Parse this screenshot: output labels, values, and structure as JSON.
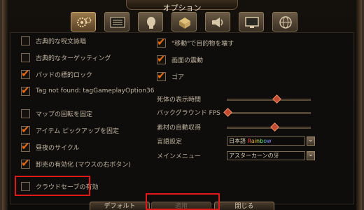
{
  "window": {
    "title": "オプション"
  },
  "tabs": [
    {
      "icon": "gameplay-gears-icon",
      "active": true
    },
    {
      "icon": "display-list-icon",
      "active": false
    },
    {
      "icon": "character-head-icon",
      "active": false
    },
    {
      "icon": "inventory-crate-icon",
      "active": false
    },
    {
      "icon": "audio-speaker-icon",
      "active": false
    },
    {
      "icon": "monitor-icon",
      "active": false
    },
    {
      "icon": "network-globe-icon",
      "active": false
    }
  ],
  "left_options": [
    {
      "label": "古典的な呪文詠唱",
      "checked": false
    },
    {
      "label": "古典的なターゲッティング",
      "checked": false
    },
    {
      "label": "パッドの標的ロック",
      "checked": true
    },
    {
      "label": "Tag not found: tagGameplayOption36",
      "checked": true
    },
    {
      "label": "マップの回転を固定",
      "checked": false
    },
    {
      "label": "アイテム ピックアップを固定",
      "checked": true
    },
    {
      "label": "昼夜のサイクル",
      "checked": true
    },
    {
      "label": "卸売の有効化 (マウスの右ボタン)",
      "checked": true
    },
    {
      "label": "クラウドセーブの有効",
      "checked": false
    }
  ],
  "right_options": [
    {
      "label": "\"移動\"で目的物を壊す",
      "checked": true
    },
    {
      "label": "画面の震動",
      "checked": true
    },
    {
      "label": "ゴア",
      "checked": true
    }
  ],
  "sliders": [
    {
      "label": "死体の表示時間",
      "value": 0.58
    },
    {
      "label": "バックグラウンド FPS",
      "value": 0.0
    },
    {
      "label": "素材の自動収得",
      "value": 0.56
    }
  ],
  "dropdowns": {
    "language": {
      "label": "言語設定",
      "value_prefix": "日本語 ",
      "value_rainbow": "Rainbow"
    },
    "main_menu": {
      "label": "メインメニュー",
      "value": "アスターカーンの牙"
    }
  },
  "buttons": {
    "default": "デフォルト",
    "apply": "適用",
    "close": "閉じる"
  },
  "colors": {
    "accent": "#e86a10",
    "highlight": "#e01818"
  }
}
